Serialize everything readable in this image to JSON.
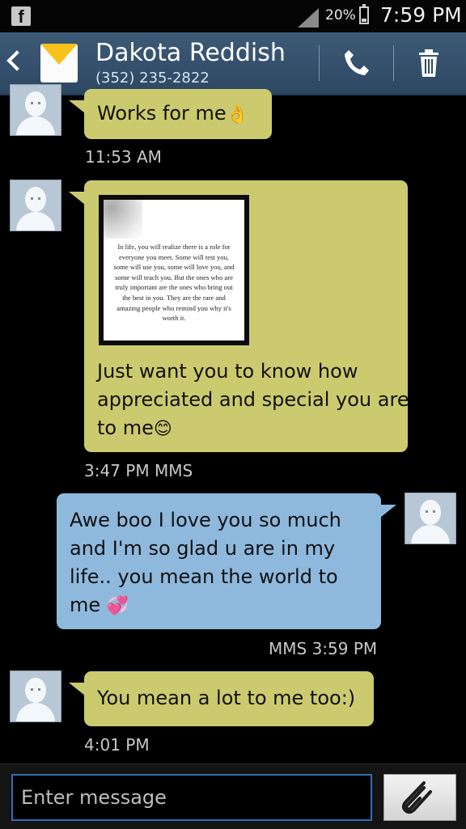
{
  "statusbar": {
    "app_icon": "facebook-icon",
    "battery_percent": "20%",
    "time": "7:59 PM"
  },
  "header": {
    "contact_name": "Dakota Reddish",
    "contact_number": "(352) 235-2822",
    "back_icon": "back-icon",
    "contact_icon": "mail-icon",
    "call_icon": "phone-icon",
    "delete_icon": "trash-icon",
    "accent_color": "#334f6b"
  },
  "messages": [
    {
      "direction": "incoming",
      "text": "Works for me",
      "emoji": "👌",
      "timestamp": "11:53 AM"
    },
    {
      "direction": "incoming",
      "mms_quote": "In life, you will realize there is a role for everyone you meet. Some will test you, some will use you, some will love you, and some will teach you. But the ones who are truly important are the ones who bring out the best in you. They are the rare and amazing people who remind you why it's worth it.",
      "text": "Just want you to know how appreciated and special you are to me",
      "emoji": "😊",
      "timestamp": "3:47 PM MMS"
    },
    {
      "direction": "outgoing",
      "text": "Awe boo I love you so much and I'm so glad u are in my life.. you mean the world to me",
      "emoji": "💞",
      "timestamp": "MMS 3:59 PM"
    },
    {
      "direction": "incoming",
      "text": "You mean a lot to me too:)",
      "emoji": "",
      "timestamp": "4:01 PM"
    }
  ],
  "composer": {
    "placeholder": "Enter message",
    "attach_icon": "paperclip-icon"
  },
  "colors": {
    "incoming_bubble": "#ccca6e",
    "outgoing_bubble": "#8eb9dd",
    "background": "#000000"
  }
}
